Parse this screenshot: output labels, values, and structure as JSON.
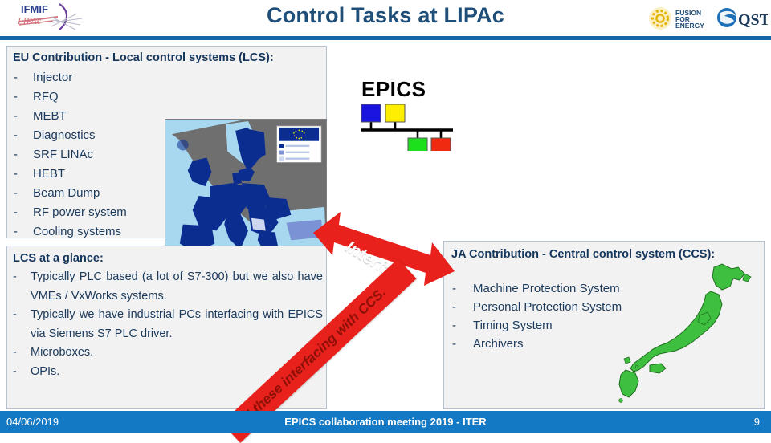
{
  "header": {
    "title": "Control Tasks at LIPAc",
    "logo_left_top": "IFMIF",
    "logo_left_bottom": "LIPAc",
    "logo_f4e_line1": "FUSION",
    "logo_f4e_line2": "FOR",
    "logo_f4e_line3": "ENERGY",
    "logo_qst": "QST",
    "rule_color": "#1565a7",
    "title_color": "#1f4e79"
  },
  "eu_panel": {
    "title": "EU Contribution - Local control systems (LCS):",
    "dash": "-",
    "items": [
      "Injector",
      "RFQ",
      "MEBT",
      "Diagnostics",
      "SRF LINAc",
      "HEBT",
      "Beam Dump",
      "RF power system",
      "Cooling systems"
    ],
    "map_name": "european-union-member-states-map",
    "map_land_color": "#0b2d8f",
    "map_sea_color": "#a8d8f0",
    "map_outside_color": "#6f6f6f"
  },
  "epics": {
    "wordmark": "EPICS",
    "node_colors": [
      "#1a14e0",
      "#ffee00",
      "#1de01d",
      "#f02a10"
    ],
    "bus_color": "#000000"
  },
  "lcs_panel": {
    "title": "LCS at a glance:",
    "dash": "-",
    "items": [
      "Typically PLC based (a lot of S7-300) but we also have VMEs / VxWorks systems.",
      "Typically we have industrial PCs interfacing with EPICS via Siemens S7 PLC driver.",
      "Microboxes.",
      "OPIs."
    ]
  },
  "interface_arrow": {
    "label": "Interface",
    "color": "#e8211c"
  },
  "ccs_ribbon": {
    "label": "All these interfacing with CCS.",
    "fill_color": "#e8211c",
    "text_color": "#8c1008"
  },
  "ja_panel": {
    "title": "JA Contribution - Central control system (CCS):",
    "dash": "-",
    "items": [
      "Machine Protection System",
      "Personal Protection System",
      "Timing System",
      "Archivers"
    ],
    "map_name": "japan-map",
    "map_land_color": "#3fbf3f"
  },
  "footer": {
    "date": "04/06/2019",
    "center": "EPICS collaboration meeting  2019 - ITER",
    "page": "9",
    "bar_color": "#1479c4"
  }
}
